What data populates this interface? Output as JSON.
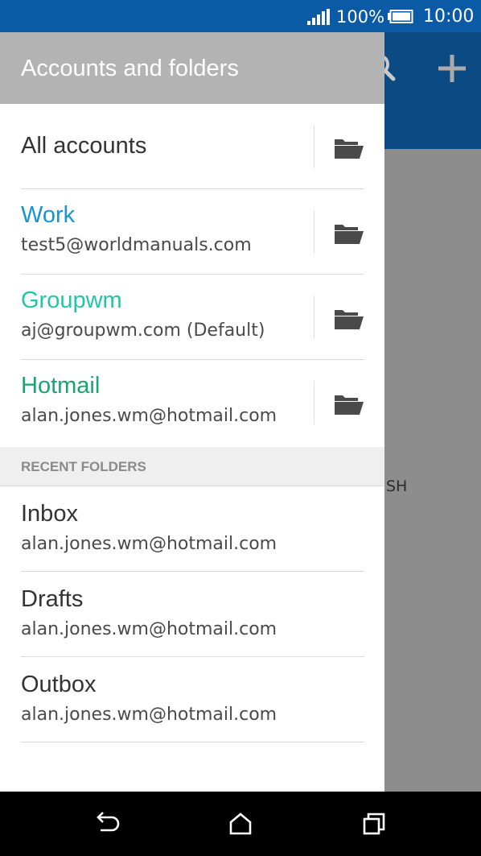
{
  "status_bar": {
    "battery_percent": "100%",
    "time": "10:00"
  },
  "background_app": {
    "partial_text": "SH",
    "icons": [
      "search-icon",
      "plus-icon"
    ]
  },
  "drawer": {
    "title": "Accounts and folders",
    "accounts": [
      {
        "name": "All accounts",
        "email": "",
        "color": "#333333",
        "icon": "folder-open-icon"
      },
      {
        "name": "Work",
        "email": "test5@worldmanuals.com",
        "color": "#1a93d1",
        "icon": "folder-open-icon"
      },
      {
        "name": "Groupwm",
        "email": "aj@groupwm.com (Default)",
        "color": "#22c5a7",
        "icon": "folder-open-icon"
      },
      {
        "name": "Hotmail",
        "email": "alan.jones.wm@hotmail.com",
        "color": "#17a673",
        "icon": "folder-open-icon"
      }
    ],
    "recent_folders_header": "RECENT FOLDERS",
    "recent_folders": [
      {
        "name": "Inbox",
        "account": "alan.jones.wm@hotmail.com"
      },
      {
        "name": "Drafts",
        "account": "alan.jones.wm@hotmail.com"
      },
      {
        "name": "Outbox",
        "account": "alan.jones.wm@hotmail.com"
      }
    ]
  },
  "nav_bar": {
    "icons": [
      "back-icon",
      "home-icon",
      "recent-apps-icon"
    ]
  },
  "colors": {
    "status_bar": "#0b5aa5",
    "app_bar": "#0b4a82",
    "drawer_header": "#b3b3b3",
    "scrim": "#8d8d8d",
    "section_header": "#efefef"
  }
}
